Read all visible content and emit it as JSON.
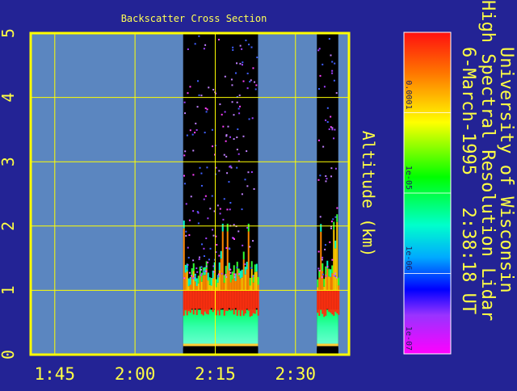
{
  "chart_data": {
    "type": "heatmap",
    "title": "Backscatter Cross Section",
    "ylabel": "Altitude (km)",
    "xlabel": "",
    "x_ticks": [
      "1:45",
      "2:00",
      "2:15",
      "2:30"
    ],
    "x_tick_minutes": [
      105,
      120,
      135,
      150
    ],
    "xlim_minutes": [
      100.5,
      160
    ],
    "y_ticks": [
      "0",
      "1",
      "2",
      "3",
      "4",
      "5"
    ],
    "ylim": [
      0,
      5
    ],
    "grid": true,
    "no_data_color": "#5b86c0",
    "data_segments": [
      {
        "start": "2:09",
        "end": "2:23"
      },
      {
        "start": "2:34",
        "end": "2:38"
      }
    ],
    "colorbar": {
      "scale": "log",
      "range": [
        1e-07,
        0.001
      ],
      "tick_labels": [
        "0.0001",
        "1e-05",
        "1e-06",
        "1e-07"
      ],
      "colors": [
        "#ff2020",
        "#ff8000",
        "#ffff00",
        "#00ff00",
        "#00ffff",
        "#0000ff",
        "#ff00ff"
      ]
    },
    "profile": {
      "description_series": "cloud layer",
      "layer_base_km": 0.65,
      "layer_top_km": 1.2
    }
  },
  "side_text": {
    "line1": "University of Wisconsin",
    "line2": "High Spectral Resolution Lidar",
    "line3": "6-March-1995   2:38:18 UT"
  },
  "colors": {
    "background": "#232395",
    "axis": "#ffff44",
    "plot_frame": "#ffff00"
  }
}
